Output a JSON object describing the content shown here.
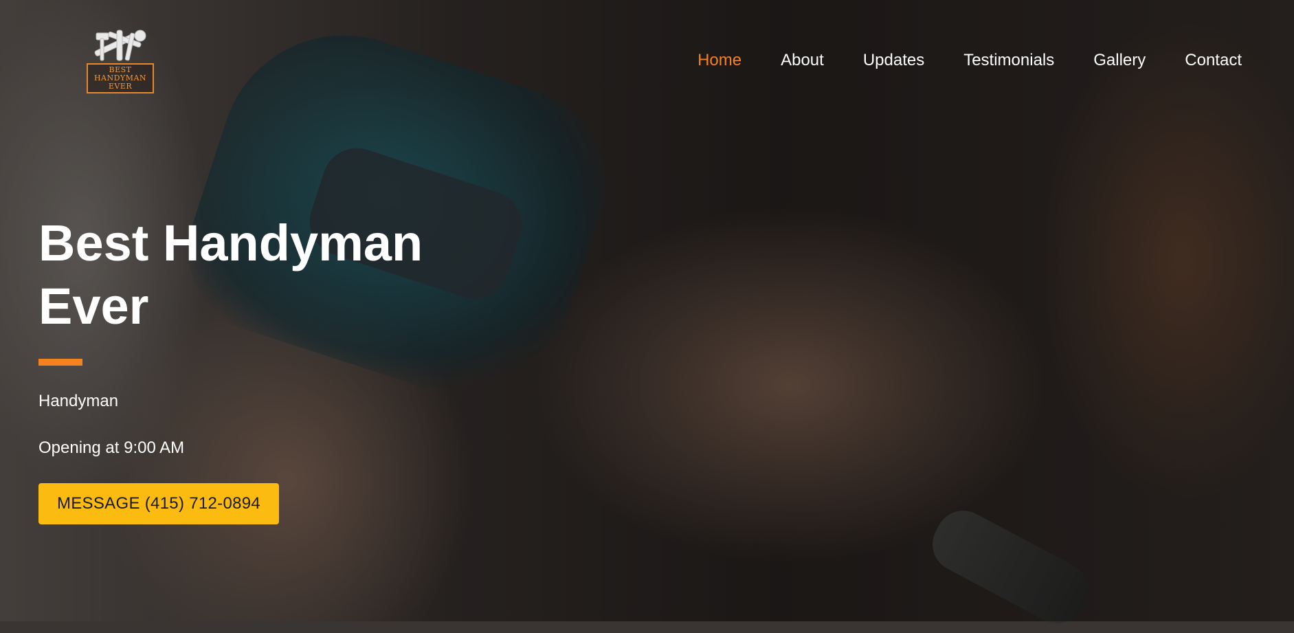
{
  "logo": {
    "lines": [
      "BEST",
      "HANDYMAN",
      "EVER"
    ]
  },
  "nav": {
    "items": [
      {
        "label": "Home",
        "active": true
      },
      {
        "label": "About"
      },
      {
        "label": "Updates"
      },
      {
        "label": "Testimonials"
      },
      {
        "label": "Gallery"
      },
      {
        "label": "Contact"
      }
    ]
  },
  "hero": {
    "title": "Best Handyman Ever",
    "tagline": "Handyman",
    "hours": "Opening at 9:00 AM",
    "cta_label": "MESSAGE (415) 712-0894"
  },
  "colors": {
    "accent": "#f5821f",
    "cta_background": "#fbbb10",
    "text": "#ffffff"
  }
}
